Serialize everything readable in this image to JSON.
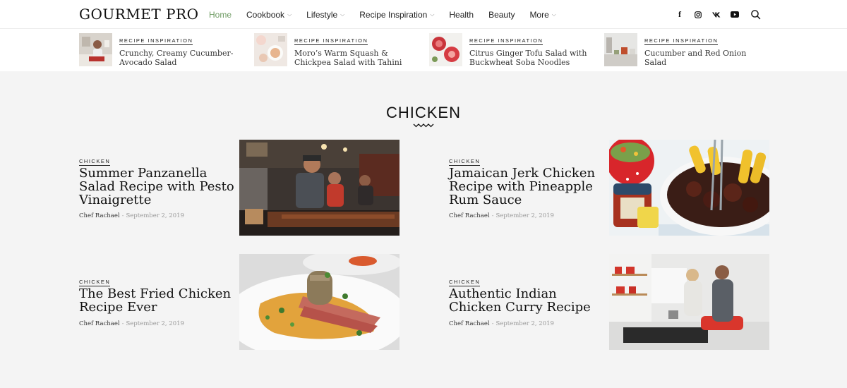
{
  "brand": {
    "logo": "GOURMET PRO"
  },
  "nav": {
    "items": [
      {
        "label": "Home",
        "dropdown": false,
        "active": true
      },
      {
        "label": "Cookbook",
        "dropdown": true
      },
      {
        "label": "Lifestyle",
        "dropdown": true
      },
      {
        "label": "Recipe Inspiration",
        "dropdown": true
      },
      {
        "label": "Health",
        "dropdown": false
      },
      {
        "label": "Beauty",
        "dropdown": false
      },
      {
        "label": "More",
        "dropdown": true
      }
    ],
    "chevron": "chevron-down-icon",
    "accent_color": "#6e9b63"
  },
  "socials": {
    "icons": [
      "facebook-icon",
      "instagram-icon",
      "vk-icon",
      "youtube-icon"
    ],
    "facebook_glyph": "f",
    "search_icon": "search-icon"
  },
  "featured": [
    {
      "category": "RECIPE INSPIRATION",
      "title": "Crunchy, Creamy Cucumber-Avocado Salad"
    },
    {
      "category": "RECIPE INSPIRATION",
      "title": "Moro’s Warm Squash & Chickpea Salad with Tahini"
    },
    {
      "category": "RECIPE INSPIRATION",
      "title": "Citrus Ginger Tofu Salad with Buckwheat Soba Noodles"
    },
    {
      "category": "RECIPE INSPIRATION",
      "title": "Cucumber and Red Onion Salad"
    }
  ],
  "section": {
    "title": "CHICKEN"
  },
  "posts": [
    {
      "category": "CHICKEN",
      "title": "Summer Panzanella Salad Recipe with Pesto Vinaigrette",
      "author": "Chef Rachael",
      "separator": "-",
      "date": "September 2, 2019"
    },
    {
      "category": "CHICKEN",
      "title": "Jamaican Jerk Chicken Recipe with Pineapple Rum Sauce",
      "author": "Chef Rachael",
      "separator": "-",
      "date": "September 2, 2019"
    },
    {
      "category": "CHICKEN",
      "title": "The Best Fried Chicken Recipe Ever",
      "author": "Chef Rachael",
      "separator": "-",
      "date": "September 2, 2019"
    },
    {
      "category": "CHICKEN",
      "title": "Authentic Indian Chicken Curry Recipe",
      "author": "Chef Rachael",
      "separator": "-",
      "date": "September 2, 2019"
    }
  ]
}
